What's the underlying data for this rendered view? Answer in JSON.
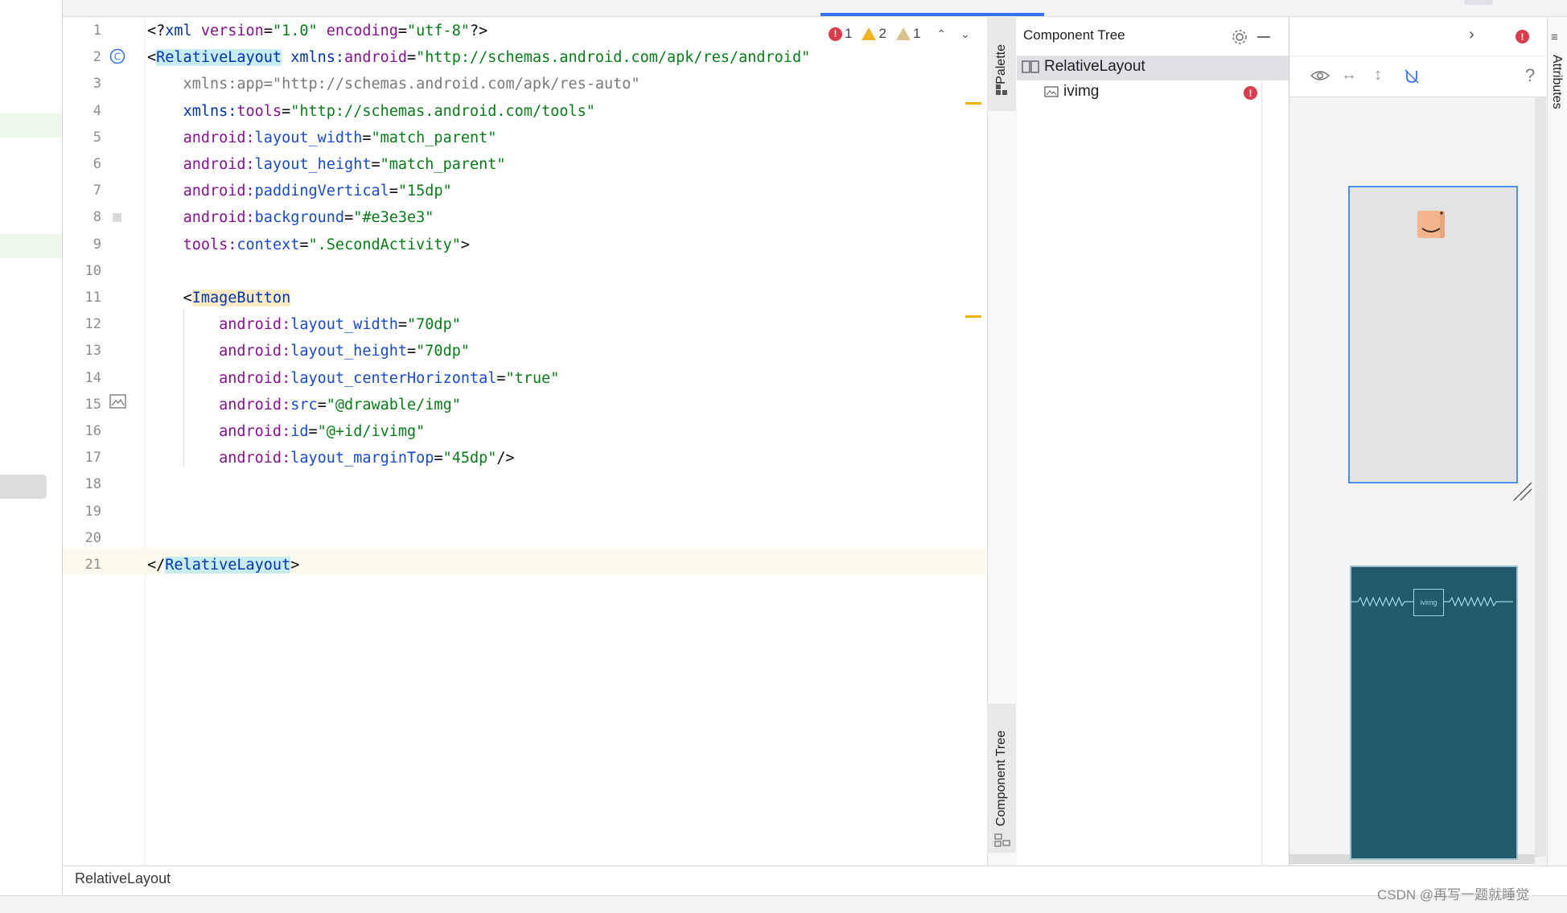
{
  "editor": {
    "line_numbers": [
      "1",
      "2",
      "3",
      "4",
      "5",
      "6",
      "7",
      "8",
      "9",
      "10",
      "11",
      "12",
      "13",
      "14",
      "15",
      "16",
      "17",
      "18",
      "19",
      "20",
      "21"
    ],
    "lines": [
      [
        [
          "<?",
          "plain"
        ],
        [
          "xml",
          "tag"
        ],
        [
          " version",
          "attr"
        ],
        [
          "=",
          "plain"
        ],
        [
          "\"1.0\"",
          "str"
        ],
        [
          " encoding",
          "attr"
        ],
        [
          "=",
          "plain"
        ],
        [
          "\"utf-8\"",
          "str"
        ],
        [
          "?>",
          "plain"
        ]
      ],
      [
        [
          "<",
          "plain"
        ],
        [
          "RelativeLayout",
          "tag-hl"
        ],
        [
          " xmlns:",
          "tag"
        ],
        [
          "android",
          "attr"
        ],
        [
          "=",
          "plain"
        ],
        [
          "\"http://schemas.android.com/apk/res/android\"",
          "str"
        ]
      ],
      [
        [
          "    xmlns:app=\"http://schemas.android.com/apk/res-auto\"",
          "faded"
        ]
      ],
      [
        [
          "    ",
          "plain"
        ],
        [
          "xmlns:",
          "tag"
        ],
        [
          "tools",
          "attr"
        ],
        [
          "=",
          "plain"
        ],
        [
          "\"http://schemas.android.com/tools\"",
          "str"
        ]
      ],
      [
        [
          "    ",
          "plain"
        ],
        [
          "android:",
          "attr"
        ],
        [
          "layout_width",
          "ns"
        ],
        [
          "=",
          "plain"
        ],
        [
          "\"match_parent\"",
          "str"
        ]
      ],
      [
        [
          "    ",
          "plain"
        ],
        [
          "android:",
          "attr"
        ],
        [
          "layout_height",
          "ns"
        ],
        [
          "=",
          "plain"
        ],
        [
          "\"match_parent\"",
          "str"
        ]
      ],
      [
        [
          "    ",
          "plain"
        ],
        [
          "android:",
          "attr"
        ],
        [
          "paddingVertical",
          "ns"
        ],
        [
          "=",
          "plain"
        ],
        [
          "\"15dp\"",
          "str"
        ]
      ],
      [
        [
          "    ",
          "plain"
        ],
        [
          "android:",
          "attr"
        ],
        [
          "background",
          "ns"
        ],
        [
          "=",
          "plain"
        ],
        [
          "\"#e3e3e3\"",
          "str"
        ]
      ],
      [
        [
          "    ",
          "plain"
        ],
        [
          "tools:",
          "attr"
        ],
        [
          "context",
          "ns"
        ],
        [
          "=",
          "plain"
        ],
        [
          "\".SecondActivity\"",
          "str"
        ],
        [
          ">",
          "plain"
        ]
      ],
      [
        [
          "",
          "plain"
        ]
      ],
      [
        [
          "    <",
          "plain"
        ],
        [
          "ImageButton",
          "tag-ib"
        ]
      ],
      [
        [
          "        ",
          "plain"
        ],
        [
          "android:",
          "attr"
        ],
        [
          "layout_width",
          "ns"
        ],
        [
          "=",
          "plain"
        ],
        [
          "\"70dp\"",
          "str"
        ]
      ],
      [
        [
          "        ",
          "plain"
        ],
        [
          "android:",
          "attr"
        ],
        [
          "layout_height",
          "ns"
        ],
        [
          "=",
          "plain"
        ],
        [
          "\"70dp\"",
          "str"
        ]
      ],
      [
        [
          "        ",
          "plain"
        ],
        [
          "android:",
          "attr"
        ],
        [
          "layout_centerHorizontal",
          "ns"
        ],
        [
          "=",
          "plain"
        ],
        [
          "\"true\"",
          "str"
        ]
      ],
      [
        [
          "        ",
          "plain"
        ],
        [
          "android:",
          "attr"
        ],
        [
          "src",
          "ns"
        ],
        [
          "=",
          "plain"
        ],
        [
          "\"@drawable/img\"",
          "str"
        ]
      ],
      [
        [
          "        ",
          "plain"
        ],
        [
          "android:",
          "attr"
        ],
        [
          "id",
          "ns"
        ],
        [
          "=",
          "plain"
        ],
        [
          "\"@+id/ivimg\"",
          "str"
        ]
      ],
      [
        [
          "        ",
          "plain"
        ],
        [
          "android:",
          "attr"
        ],
        [
          "layout_marginTop",
          "ns"
        ],
        [
          "=",
          "plain"
        ],
        [
          "\"45dp\"",
          "str"
        ],
        [
          "/>",
          "plain"
        ]
      ],
      [
        [
          "",
          "plain"
        ]
      ],
      [
        [
          "",
          "plain"
        ]
      ],
      [
        [
          "",
          "plain"
        ]
      ],
      [
        [
          "</",
          "plain"
        ],
        [
          "RelativeLayout",
          "tag-hl"
        ],
        [
          ">",
          "plain"
        ]
      ]
    ],
    "inspections": {
      "errors": "1",
      "warnings": "2",
      "weak_warnings": "1"
    }
  },
  "side_tabs": {
    "palette": "Palette",
    "component_tree": "Component Tree",
    "attributes": "Attributes"
  },
  "component_tree": {
    "title": "Component Tree",
    "root": "RelativeLayout",
    "child": "ivimg"
  },
  "design": {
    "blueprint_label": "ivimg"
  },
  "status": {
    "breadcrumb": "RelativeLayout"
  },
  "watermark": "CSDN @再写一题就睡觉",
  "colors": {
    "error": "#db3b4b",
    "warning": "#f2b41c",
    "accent": "#3574f0",
    "blueprint": "#235a6b"
  }
}
